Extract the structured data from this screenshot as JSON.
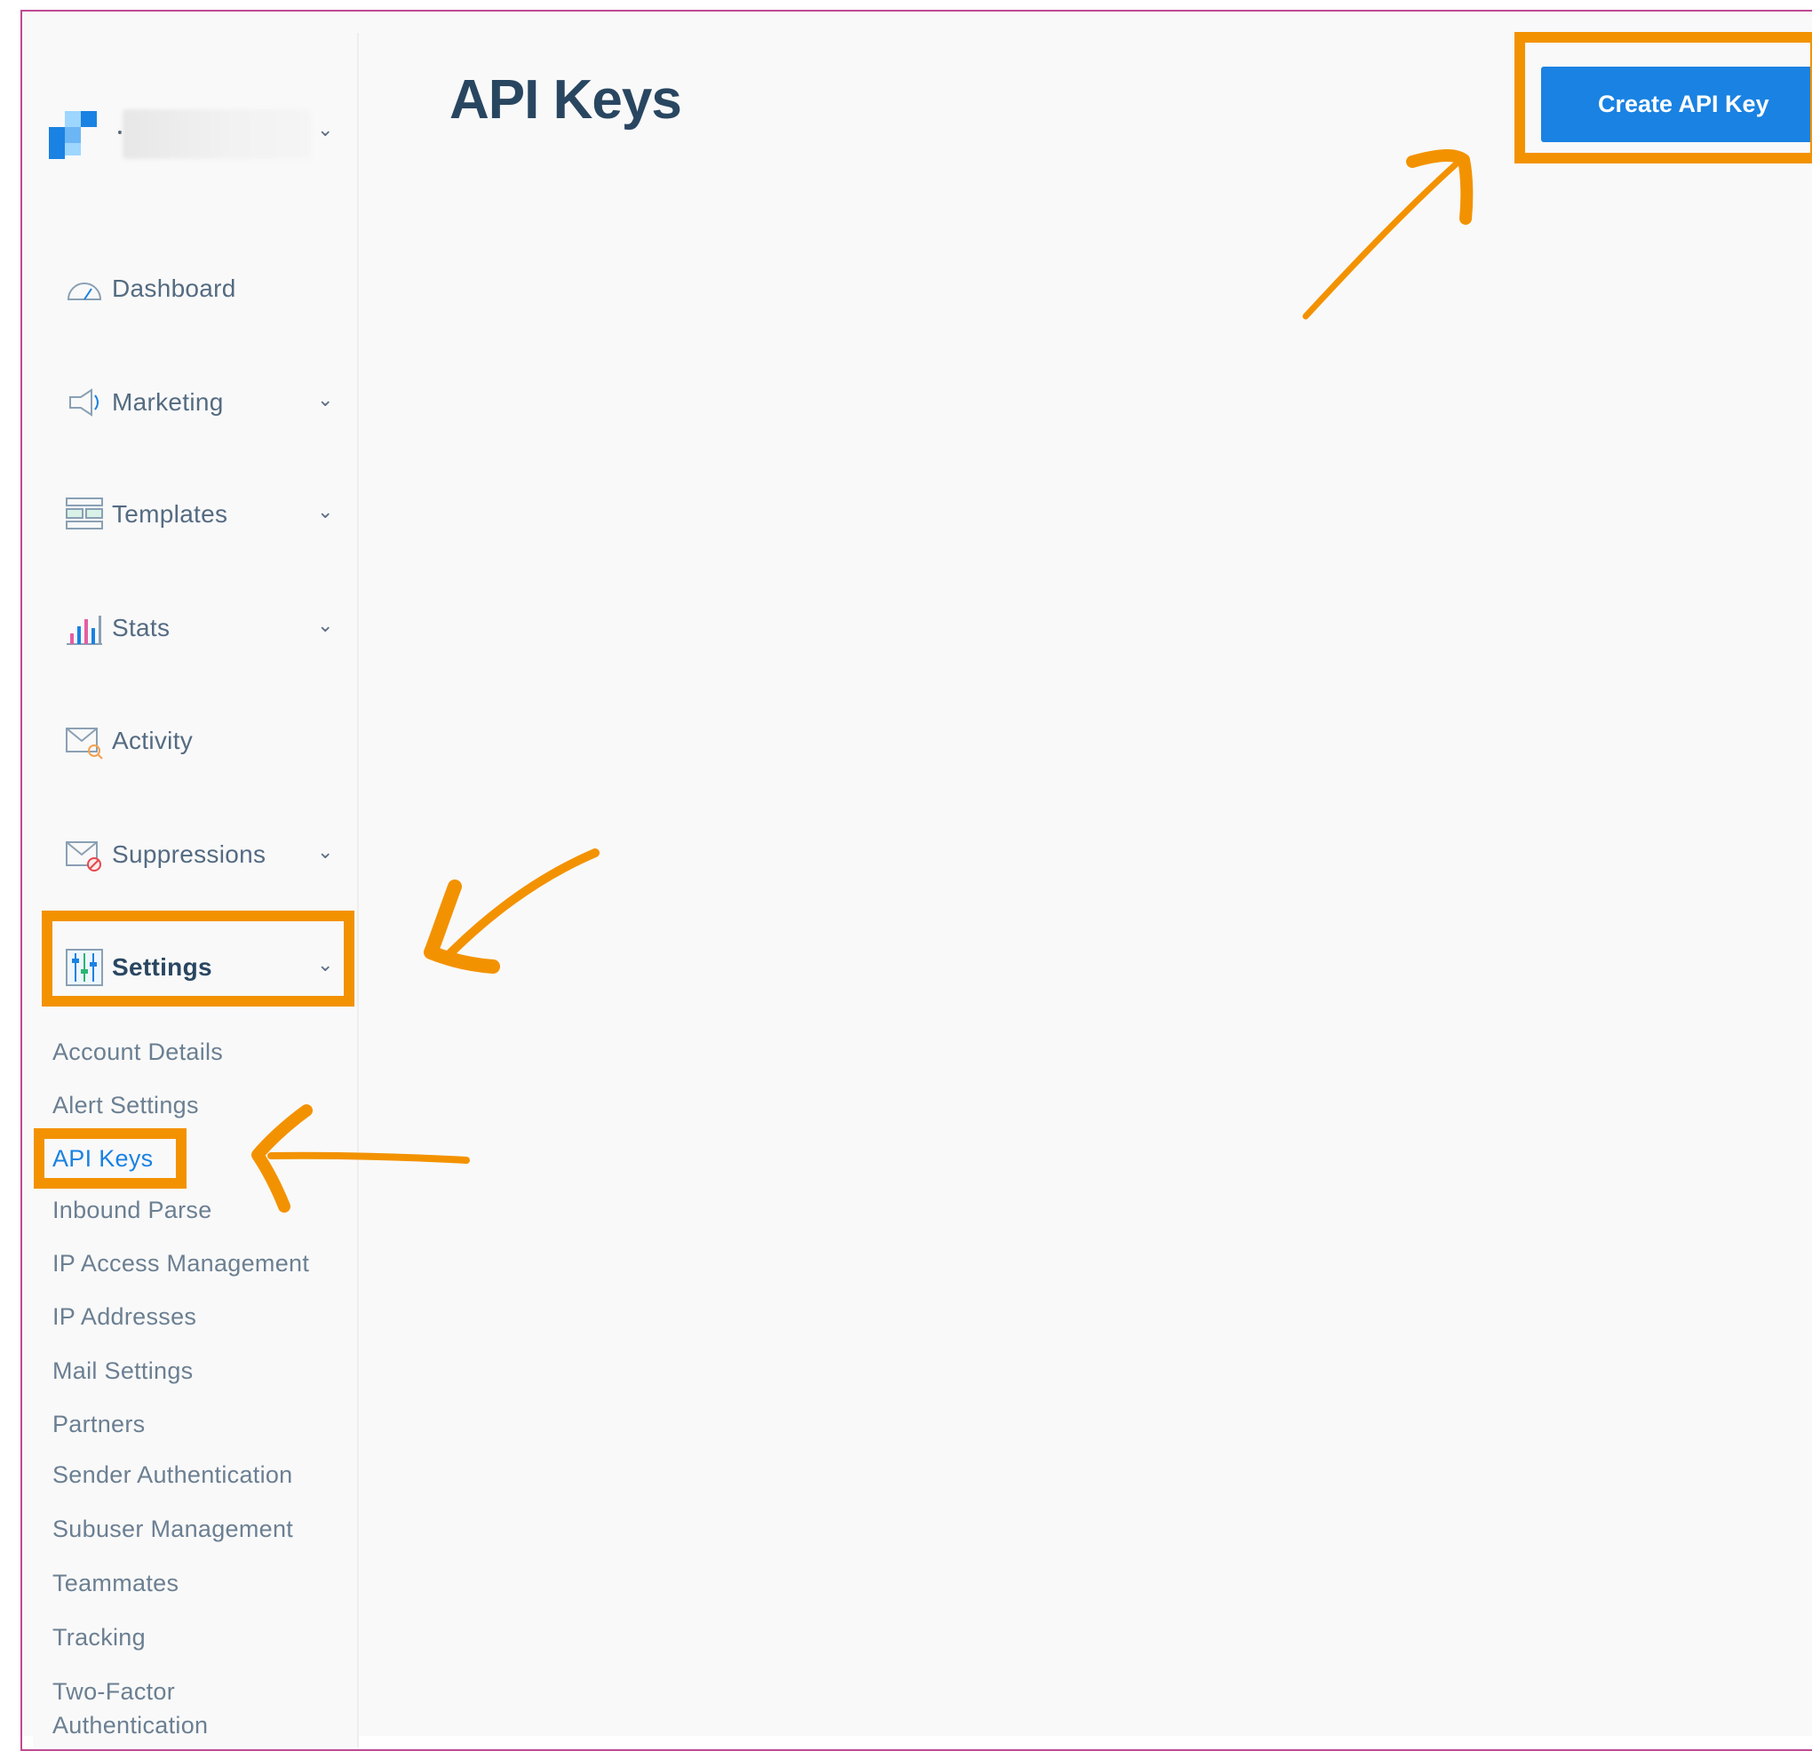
{
  "main": {
    "title": "API Keys",
    "create_button_label": "Create API Key"
  },
  "sidebar": {
    "account_name": "",
    "items": [
      {
        "label": "Dashboard",
        "icon": "dashboard-icon",
        "has_chevron": false
      },
      {
        "label": "Marketing",
        "icon": "megaphone-icon",
        "has_chevron": true
      },
      {
        "label": "Templates",
        "icon": "templates-icon",
        "has_chevron": true
      },
      {
        "label": "Stats",
        "icon": "stats-icon",
        "has_chevron": true
      },
      {
        "label": "Activity",
        "icon": "activity-icon",
        "has_chevron": false
      },
      {
        "label": "Suppressions",
        "icon": "suppressions-icon",
        "has_chevron": true
      },
      {
        "label": "Settings",
        "icon": "settings-icon",
        "has_chevron": true,
        "active": true
      }
    ],
    "settings_subitems": [
      "Account Details",
      "Alert Settings",
      "API Keys",
      "Inbound Parse",
      "IP Access Management",
      "IP Addresses",
      "Mail Settings",
      "Partners",
      "Sender Authentication",
      "Subuser Management",
      "Teammates",
      "Tracking",
      "Two-Factor Authentication"
    ],
    "active_subitem": "API Keys"
  },
  "colors": {
    "accent": "#1a82e2",
    "title": "#294661",
    "annotation": "#f39200"
  }
}
